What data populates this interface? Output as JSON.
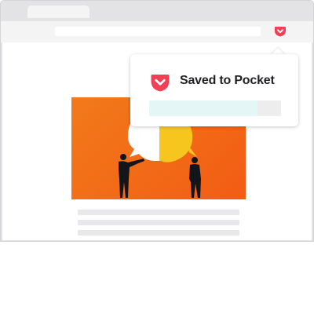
{
  "browser": {
    "tab_label": "",
    "url": ""
  },
  "toolbar": {
    "pocket_button_icon": "pocket-icon"
  },
  "popup": {
    "logo_icon": "pocket-logo-icon",
    "title": "Saved to Pocket",
    "tags_input_value": "",
    "progress": 0.82
  },
  "colors": {
    "pocket_red": "#ef4056",
    "image_orange": "#f26b16",
    "bubble_yellow": "#f6c61f",
    "silhouette": "#14151a",
    "progress_teal": "#e5f6f6"
  }
}
